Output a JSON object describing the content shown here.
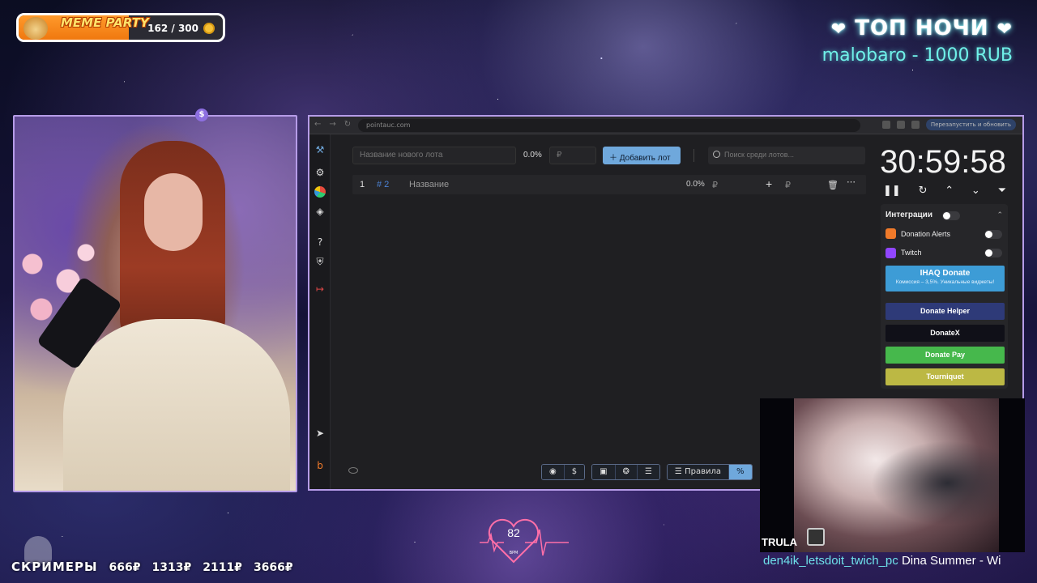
{
  "meme_party": {
    "title": "MEME PARTY",
    "current": 162,
    "max": 300,
    "count_text": "162 / 300"
  },
  "top_night": {
    "title": "ТОП НОЧИ",
    "entry": "malobaro - 1000 RUB"
  },
  "browser": {
    "url": "pointauc.com",
    "update_label": "Перезапустить и обновить",
    "new_lot_placeholder": "Название нового лота",
    "percent": "0.0%",
    "amount_placeholder": "₽",
    "add_lot_label": "Добавить лот",
    "search_placeholder": "Поиск среди лотов...",
    "lot": {
      "index": "1",
      "id": "# 2",
      "name": "Название",
      "percent": "0.0%",
      "rub": "₽",
      "rub2": "₽"
    },
    "timer": "30:59:58",
    "integrations": {
      "title": "Интеграции",
      "donation_alerts": "Donation Alerts",
      "twitch": "Twitch",
      "ihaq_title": "IHAQ Donate",
      "ihaq_subtitle": "Комиссия – 3,5%. Уникальные виджеты!",
      "donate_helper": "Donate Helper",
      "donatex": "DonateX",
      "donate_pay": "Donate Pay",
      "tourniquet": "Tourniquet"
    },
    "bottom_rules": "Правила",
    "colors": {
      "accent": "#6fa8dc",
      "lot_id": "#4c83d6",
      "ihaq": "#3d9cd6",
      "donate_helper": "#2e3a78",
      "donatex": "#101018",
      "donate_pay": "#46b84c",
      "tourniquet": "#bcb844"
    }
  },
  "music": {
    "label": "TRULA",
    "user": "den4ik_letsdoit_twich_pc",
    "track": "Dina Summer - Wi"
  },
  "heart_rate": {
    "bpm": "82",
    "unit": "BPM"
  },
  "screamers": {
    "title": "СКРИМЕРЫ",
    "values": [
      "666₽",
      "1313₽",
      "2111₽",
      "3666₽"
    ]
  }
}
